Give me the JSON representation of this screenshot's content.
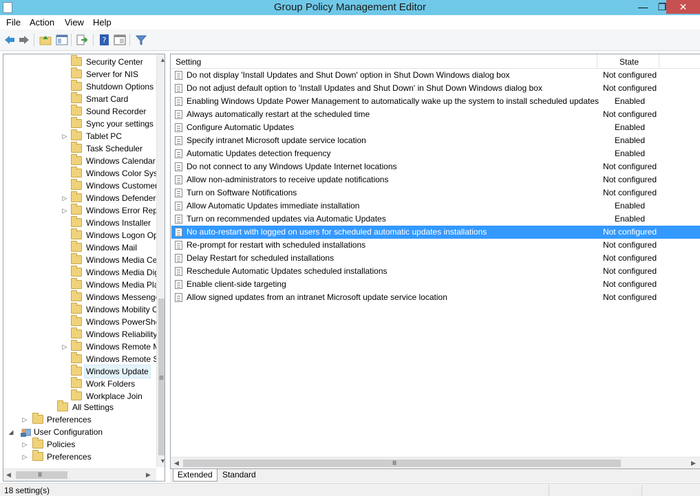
{
  "window": {
    "title": "Group Policy Management Editor",
    "min_label": "—",
    "max_label": "❐",
    "close_label": "✕"
  },
  "menu": [
    "File",
    "Action",
    "View",
    "Help"
  ],
  "tree": {
    "items": [
      {
        "label": "Security Center",
        "expander": ""
      },
      {
        "label": "Server for NIS",
        "expander": ""
      },
      {
        "label": "Shutdown Options",
        "expander": ""
      },
      {
        "label": "Smart Card",
        "expander": ""
      },
      {
        "label": "Sound Recorder",
        "expander": ""
      },
      {
        "label": "Sync your settings",
        "expander": ""
      },
      {
        "label": "Tablet PC",
        "expander": "▷"
      },
      {
        "label": "Task Scheduler",
        "expander": ""
      },
      {
        "label": "Windows Calendar",
        "expander": ""
      },
      {
        "label": "Windows Color System",
        "expander": ""
      },
      {
        "label": "Windows Customer Experience Improvement Program",
        "expander": ""
      },
      {
        "label": "Windows Defender",
        "expander": "▷"
      },
      {
        "label": "Windows Error Reporting",
        "expander": "▷"
      },
      {
        "label": "Windows Installer",
        "expander": ""
      },
      {
        "label": "Windows Logon Options",
        "expander": ""
      },
      {
        "label": "Windows Mail",
        "expander": ""
      },
      {
        "label": "Windows Media Center",
        "expander": ""
      },
      {
        "label": "Windows Media Digital Rights Management",
        "expander": ""
      },
      {
        "label": "Windows Media Player",
        "expander": ""
      },
      {
        "label": "Windows Messenger",
        "expander": ""
      },
      {
        "label": "Windows Mobility Center",
        "expander": ""
      },
      {
        "label": "Windows PowerShell",
        "expander": ""
      },
      {
        "label": "Windows Reliability Analysis",
        "expander": ""
      },
      {
        "label": "Windows Remote Management (WinRM)",
        "expander": "▷"
      },
      {
        "label": "Windows Remote Shell",
        "expander": ""
      },
      {
        "label": "Windows Update",
        "expander": "",
        "selected": true
      },
      {
        "label": "Work Folders",
        "expander": ""
      },
      {
        "label": "Workplace Join",
        "expander": ""
      }
    ],
    "all_settings": "All Settings",
    "preferences_1": "Preferences",
    "user_configuration": "User Configuration",
    "policies": "Policies",
    "preferences_2": "Preferences",
    "expand_glyph": "▷",
    "collapse_glyph": "◢"
  },
  "list": {
    "columns": {
      "setting": "Setting",
      "state": "State"
    },
    "rows": [
      {
        "setting": "Do not display 'Install Updates and Shut Down' option in Shut Down Windows dialog box",
        "state": "Not configured"
      },
      {
        "setting": "Do not adjust default option to 'Install Updates and Shut Down' in Shut Down Windows dialog box",
        "state": "Not configured"
      },
      {
        "setting": "Enabling Windows Update Power Management to automatically wake up the system to install scheduled updates",
        "state": "Enabled"
      },
      {
        "setting": "Always automatically restart at the scheduled time",
        "state": "Not configured"
      },
      {
        "setting": "Configure Automatic Updates",
        "state": "Enabled"
      },
      {
        "setting": "Specify intranet Microsoft update service location",
        "state": "Enabled"
      },
      {
        "setting": "Automatic Updates detection frequency",
        "state": "Enabled"
      },
      {
        "setting": "Do not connect to any Windows Update Internet locations",
        "state": "Not configured"
      },
      {
        "setting": "Allow non-administrators to receive update notifications",
        "state": "Not configured"
      },
      {
        "setting": "Turn on Software Notifications",
        "state": "Not configured"
      },
      {
        "setting": "Allow Automatic Updates immediate installation",
        "state": "Enabled"
      },
      {
        "setting": "Turn on recommended updates via Automatic Updates",
        "state": "Enabled"
      },
      {
        "setting": "No auto-restart with logged on users for scheduled automatic updates installations",
        "state": "Not configured",
        "selected": true
      },
      {
        "setting": "Re-prompt for restart with scheduled installations",
        "state": "Not configured"
      },
      {
        "setting": "Delay Restart for scheduled installations",
        "state": "Not configured"
      },
      {
        "setting": "Reschedule Automatic Updates scheduled installations",
        "state": "Not configured"
      },
      {
        "setting": "Enable client-side targeting",
        "state": "Not configured"
      },
      {
        "setting": "Allow signed updates from an intranet Microsoft update service location",
        "state": "Not configured"
      }
    ]
  },
  "tabs": [
    "Extended",
    "Standard"
  ],
  "status": {
    "text": "18 setting(s)"
  },
  "scroll": {
    "left": "◀",
    "right": "▶",
    "up": "▲",
    "down": "▼",
    "grip": "Ⅲ",
    "grip_v": "≡"
  },
  "icons": {
    "back": "🡐",
    "forward": "🡒"
  },
  "colors": {
    "titlebar": "#6fc8e8",
    "selection": "#3399ff",
    "close": "#c75050"
  }
}
